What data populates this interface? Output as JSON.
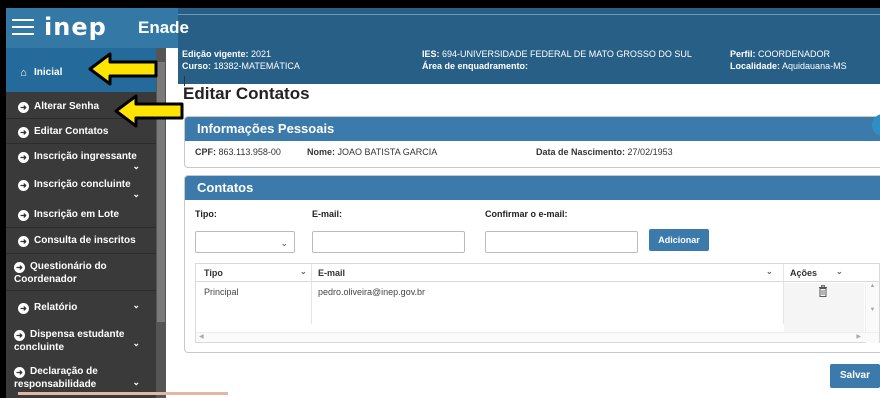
{
  "header": {
    "logo": "inep",
    "app_name": "Enade"
  },
  "context": {
    "edicao_label": "Edição vigente:",
    "edicao_value": "2021",
    "curso_label": "Curso:",
    "curso_value": "18382-MATEMÁTICA",
    "ies_label": "IES:",
    "ies_value": "694-UNIVERSIDADE FEDERAL DE MATO GROSSO DO SUL",
    "area_label": "Área de enquadramento:",
    "area_value": "",
    "perfil_label": "Perfil:",
    "perfil_value": "COORDENADOR",
    "localidade_label": "Localidade:",
    "localidade_value": "Aquidauana-MS"
  },
  "sidebar": {
    "items": [
      {
        "label": "Inicial",
        "icon": "home-icon"
      },
      {
        "label": "Alterar Senha",
        "icon": "arrow-circle-icon"
      },
      {
        "label": "Editar Contatos",
        "icon": "arrow-circle-icon"
      },
      {
        "label": "Inscrição ingressante",
        "icon": "arrow-circle-icon"
      },
      {
        "label": "Inscrição concluinte",
        "icon": "arrow-circle-icon"
      },
      {
        "label": "Inscrição em Lote",
        "icon": "arrow-circle-icon"
      },
      {
        "label": "Consulta de inscritos",
        "icon": "arrow-circle-icon"
      },
      {
        "label_line1": "Questionário do",
        "label_line2": "Coordenador",
        "icon": "arrow-circle-icon"
      },
      {
        "label": "Relatório",
        "icon": "arrow-circle-icon"
      },
      {
        "label_line1": "Dispensa estudante",
        "label_line2": "concluinte",
        "icon": "arrow-circle-icon"
      },
      {
        "label_line1": "Declaração de",
        "label_line2": "responsabilidade",
        "icon": "arrow-circle-icon"
      }
    ]
  },
  "page": {
    "title": "Editar Contatos"
  },
  "personal": {
    "heading": "Informações Pessoais",
    "cpf_label": "CPF:",
    "cpf_value": "863.113.958-00",
    "nome_label": "Nome:",
    "nome_value": "JOAO BATISTA GARCIA",
    "nasc_label": "Data de Nascimento:",
    "nasc_value": "27/02/1953"
  },
  "contacts": {
    "heading": "Contatos",
    "tipo_label": "Tipo:",
    "email_label": "E-mail:",
    "confirm_label": "Confirmar o e-mail:",
    "tipo_value": "",
    "email_value": "",
    "confirm_value": "",
    "add_button": "Adicionar",
    "columns": [
      "Tipo",
      "E-mail",
      "Ações"
    ],
    "rows": [
      {
        "tipo": "Principal",
        "email": "pedro.oliveira@inep.gov.br"
      }
    ]
  },
  "save_button": "Salvar",
  "colors": {
    "header": "#285f86",
    "panel_head": "#3c7aab",
    "sidebar": "#3a3a3a",
    "arrow": "#ffe400"
  }
}
